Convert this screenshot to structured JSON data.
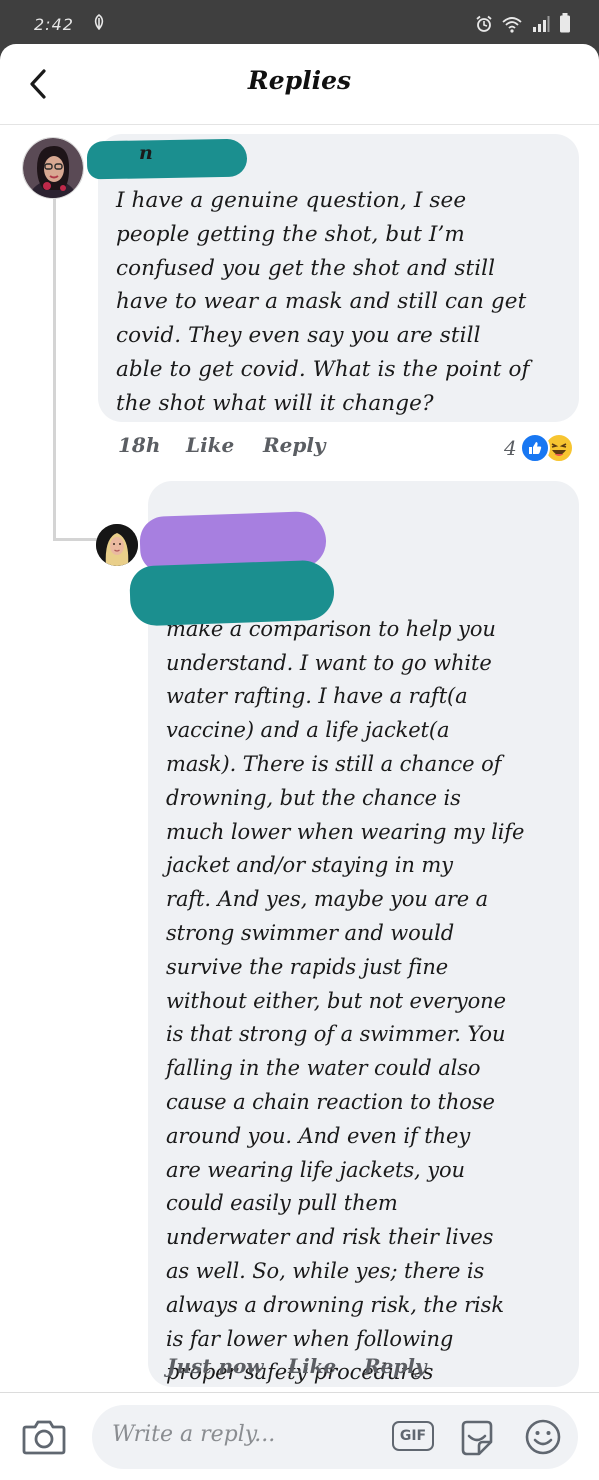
{
  "status_bar": {
    "time": "2:42",
    "notification_icon": "leaf-notification-icon",
    "icons": [
      "alarm-icon",
      "wifi-icon",
      "signal-icon",
      "battery-icon"
    ]
  },
  "header": {
    "title": "Replies",
    "back_icon": "chevron-left-icon"
  },
  "comments": [
    {
      "author_visible": "n",
      "author_redacted": true,
      "text": "I have a genuine question, I see\npeople getting the shot, but I’m\nconfused you get the shot and still\nhave to wear a mask and still can get\ncovid. They even say you are still\nable to get covid. What is the point of\nthe shot what will it change?",
      "time": "18h",
      "like_label": "Like",
      "reply_label": "Reply",
      "reaction_count": "4",
      "reactions": [
        "like",
        "haha"
      ]
    },
    {
      "author_redacted": true,
      "text": "let me try and\nmake a comparison to help you\nunderstand. I want to go white\nwater rafting. I have a raft(a\nvaccine) and a life jacket(a\nmask). There is still a chance of\ndrowning, but the chance is\nmuch lower when wearing my life\njacket and/or staying in my\nraft. And yes, maybe you are a\nstrong swimmer and would\nsurvive the rapids just fine\nwithout either, but not everyone\nis that strong of a swimmer. You\nfalling in the water could also\ncause a chain reaction to those\naround you. And even if they\nare wearing life jackets, you\ncould easily pull them\nunderwater and risk their lives\nas well. So, while yes; there is\nalways a drowning risk, the risk\nis far lower when following\nproper safety procedures",
      "time": "Just now",
      "like_label": "Like",
      "reply_label": "Reply"
    }
  ],
  "composer": {
    "placeholder": "Write a reply...",
    "gif_label": "GIF",
    "icons": [
      "camera-icon",
      "gif-icon",
      "sticker-icon",
      "emoji-icon"
    ]
  },
  "colors": {
    "bubble": "#eff1f4",
    "meta_text": "#5b5e63",
    "like_blue": "#1877f2",
    "redaction_teal": "#1b8f8f",
    "redaction_purple": "#a77fe0"
  }
}
